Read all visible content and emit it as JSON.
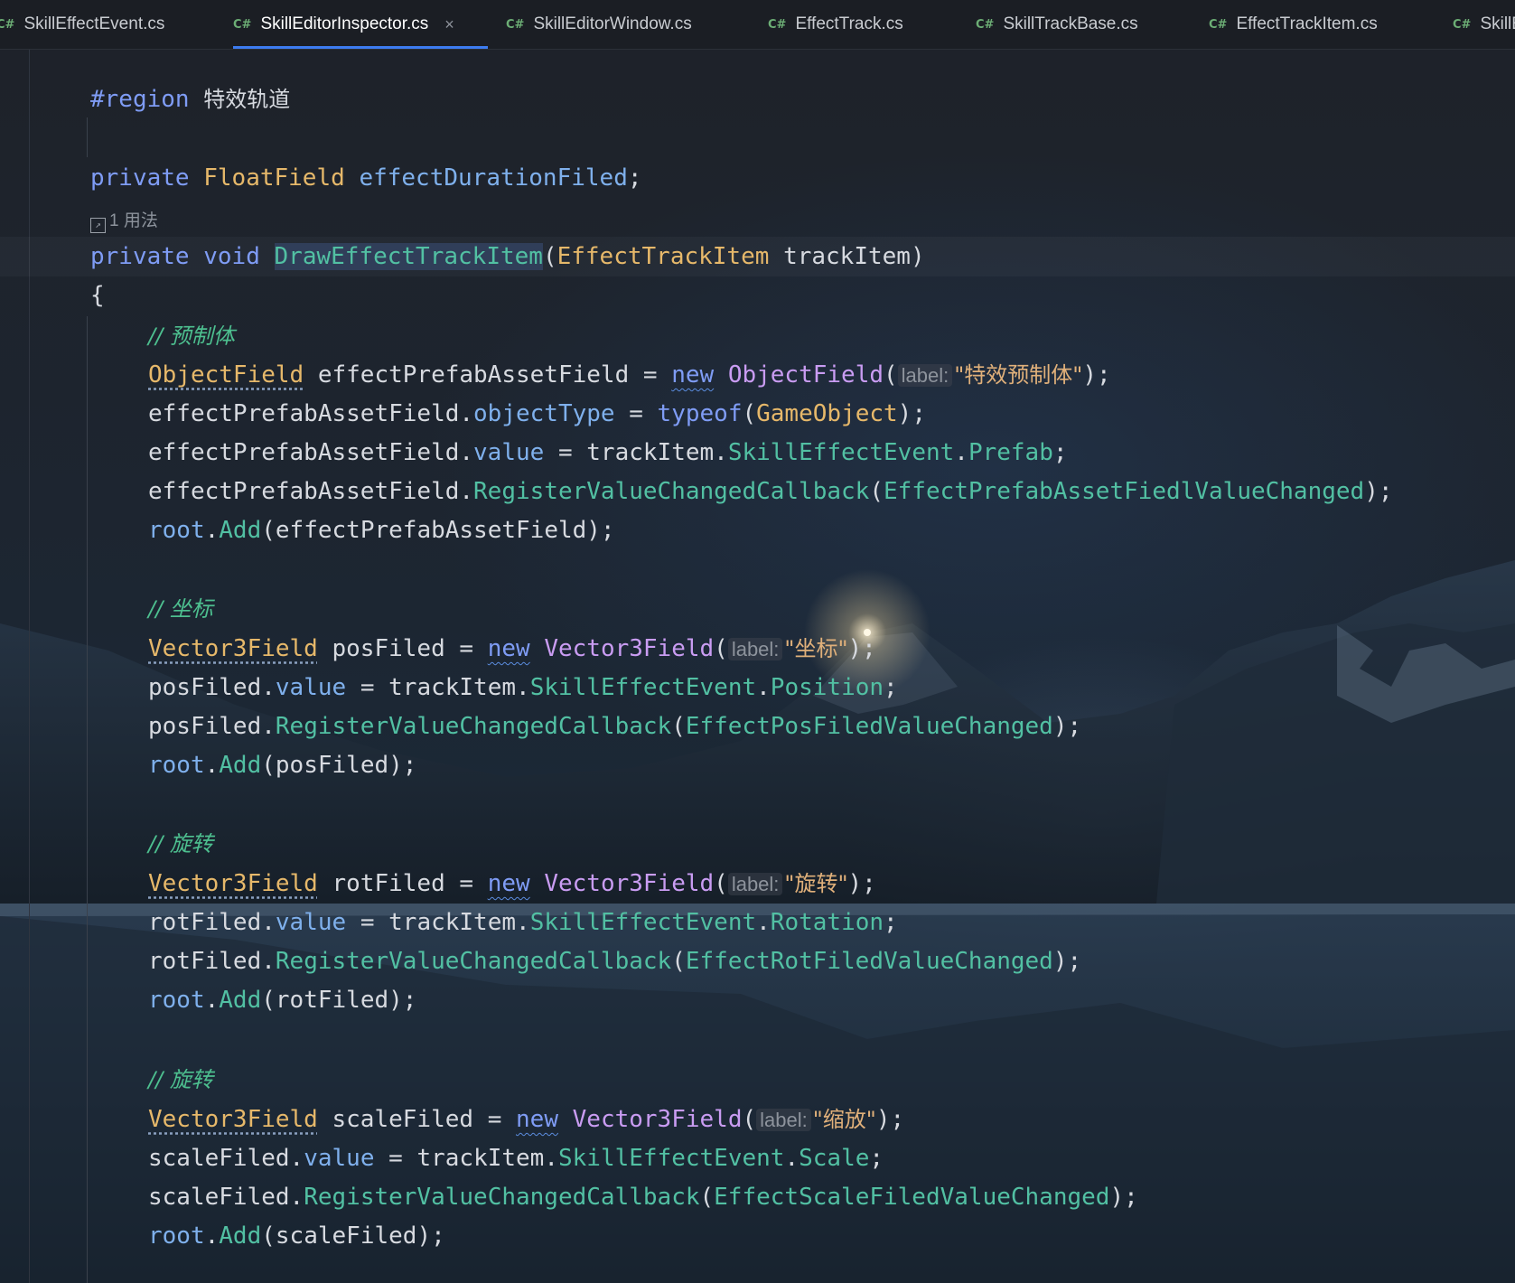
{
  "tabs": [
    {
      "icon": "C#",
      "label": "SkillEffectEvent.cs",
      "active": false
    },
    {
      "icon": "C#",
      "label": "SkillEditorInspector.cs",
      "active": true,
      "close": "×"
    },
    {
      "icon": "C#",
      "label": "SkillEditorWindow.cs",
      "active": false
    },
    {
      "icon": "C#",
      "label": "EffectTrack.cs",
      "active": false
    },
    {
      "icon": "C#",
      "label": "SkillTrackBase.cs",
      "active": false
    },
    {
      "icon": "C#",
      "label": "EffectTrackItem.cs",
      "active": false
    },
    {
      "icon": "C#",
      "label": "SkillE",
      "active": false
    }
  ],
  "code": {
    "region_kw": "#region",
    "region_name": "特效轨道",
    "field_private": "private",
    "field_type": "FloatField",
    "field_name": "effectDurationFiled",
    "field_semicolon": ";",
    "usages": "1 用法",
    "method_private": "private",
    "method_void": "void",
    "method_name": "DrawEffectTrackItem",
    "method_paren_open": "(",
    "param_type": "EffectTrackItem",
    "param_name": "trackItem",
    "method_paren_close": ")",
    "brace_open": "{",
    "blocks": [
      {
        "comment": "// 预制体",
        "decl_type": "ObjectField",
        "decl_var": "effectPrefabAssetField",
        "ctor_class": "ObjectField",
        "hint": "label:",
        "label_str": "\"特效预制体\"",
        "extra_lines": [
          {
            "obj": "effectPrefabAssetField",
            "member": "objectType",
            "rhs_kw": "typeof",
            "rhs_arg": "GameObject"
          }
        ],
        "value_obj": "effectPrefabAssetField",
        "value_prop": "SkillEffectEvent",
        "value_leaf": "Prefab",
        "callback_obj": "effectPrefabAssetField",
        "callback_method": "RegisterValueChangedCallback",
        "callback_arg": "EffectPrefabAssetFiedlValueChanged",
        "add_arg": "effectPrefabAssetField"
      },
      {
        "comment": "// 坐标",
        "decl_type": "Vector3Field",
        "decl_var": "posFiled",
        "ctor_class": "Vector3Field",
        "hint": "label:",
        "label_str": "\"坐标\"",
        "value_obj": "posFiled",
        "value_prop": "SkillEffectEvent",
        "value_leaf": "Position",
        "callback_obj": "posFiled",
        "callback_method": "RegisterValueChangedCallback",
        "callback_arg": "EffectPosFiledValueChanged",
        "add_arg": "posFiled"
      },
      {
        "comment": "// 旋转",
        "decl_type": "Vector3Field",
        "decl_var": "rotFiled",
        "ctor_class": "Vector3Field",
        "hint": "label:",
        "label_str": "\"旋转\"",
        "value_obj": "rotFiled",
        "value_prop": "SkillEffectEvent",
        "value_leaf": "Rotation",
        "callback_obj": "rotFiled",
        "callback_method": "RegisterValueChangedCallback",
        "callback_arg": "EffectRotFiledValueChanged",
        "add_arg": "rotFiled"
      },
      {
        "comment": "// 旋转",
        "decl_type": "Vector3Field",
        "decl_var": "scaleFiled",
        "ctor_class": "Vector3Field",
        "hint": "label:",
        "label_str": "\"缩放\"",
        "value_obj": "scaleFiled",
        "value_prop": "SkillEffectEvent",
        "value_leaf": "Scale",
        "callback_obj": "scaleFiled",
        "callback_method": "RegisterValueChangedCallback",
        "callback_arg": "EffectScaleFiledValueChanged",
        "add_arg": "scaleFiled"
      }
    ],
    "kw_new": "new",
    "kw_value": "value",
    "kw_trackItem": "trackItem",
    "kw_root": "root",
    "kw_add": "Add"
  },
  "colors": {
    "keyword": "#7f9cf5",
    "type": "#e6b86a",
    "property": "#7fb0ec",
    "method": "#52c0a3",
    "class": "#c99cf2",
    "string": "#e0b07a",
    "comment": "#4dbf8f",
    "active_tab_underline": "#3d7cf0"
  }
}
